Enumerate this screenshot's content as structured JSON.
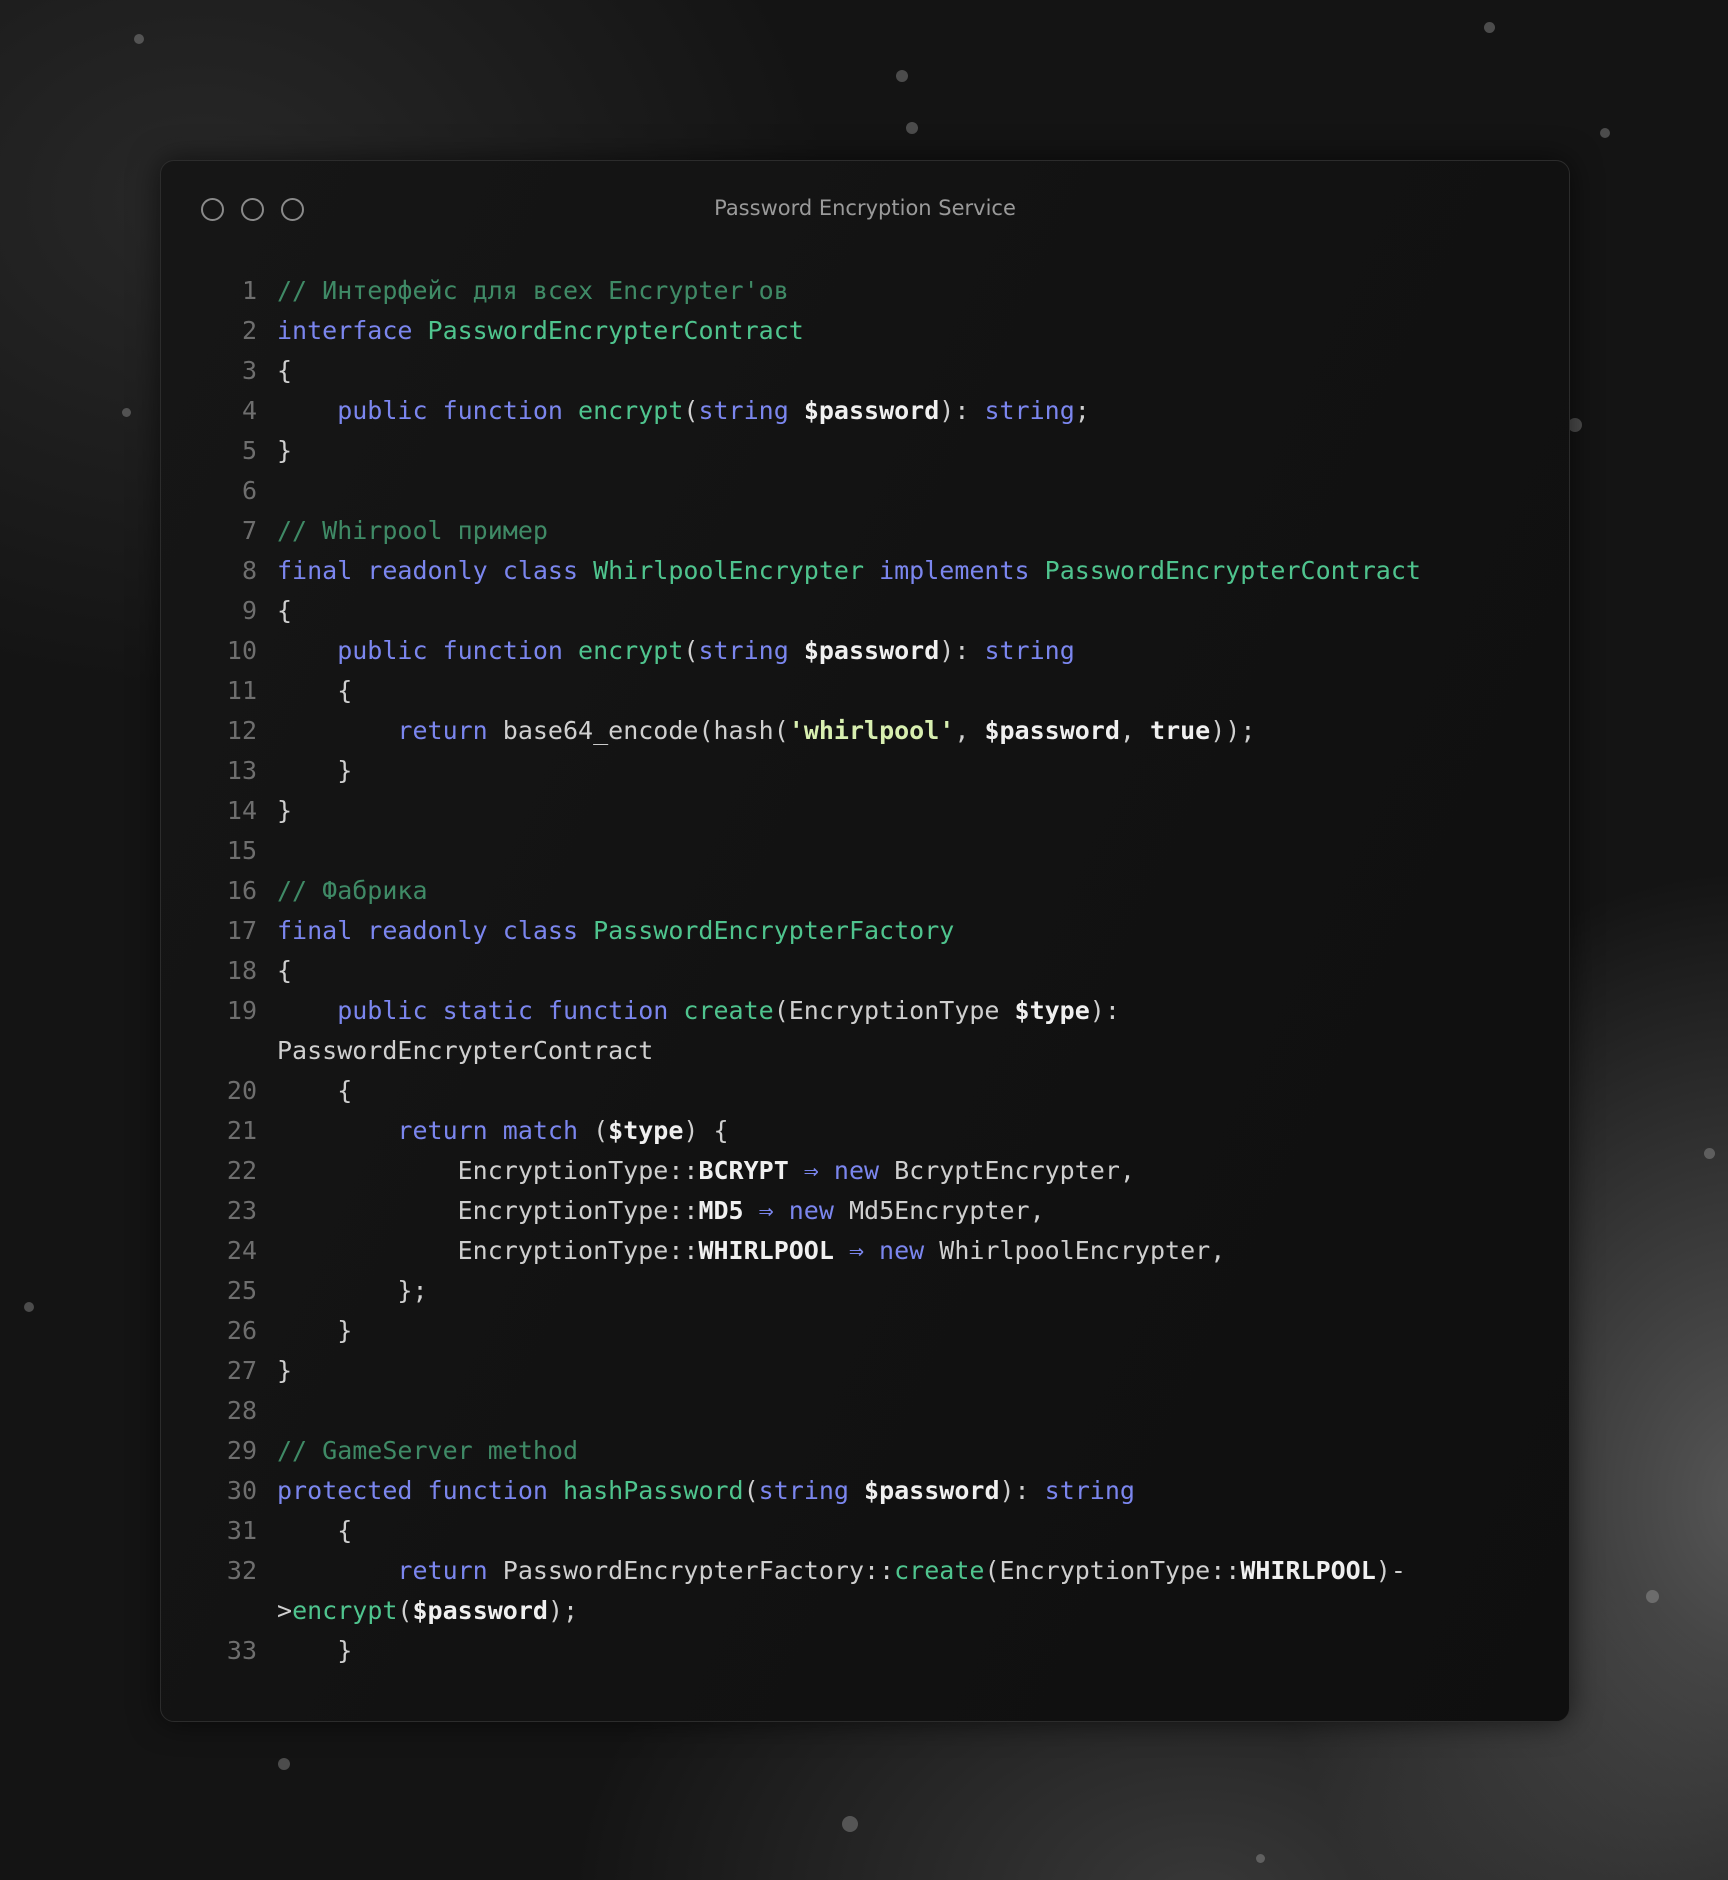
{
  "window": {
    "title": "Password Encryption Service"
  },
  "colors": {
    "keyword": "#7b86ee",
    "identifier": "#4fc48e",
    "comment": "#3f8a66",
    "string": "#d8efb0",
    "text": "#cfcfcf"
  },
  "code": {
    "lines": [
      {
        "n": "1",
        "t": [
          [
            "c",
            "// Интерфейс для всех Encrypter'ов"
          ]
        ]
      },
      {
        "n": "2",
        "t": [
          [
            "k",
            "interface "
          ],
          [
            "f",
            "PasswordEncrypterContract"
          ]
        ]
      },
      {
        "n": "3",
        "t": [
          [
            "p",
            "{"
          ]
        ]
      },
      {
        "n": "4",
        "t": [
          [
            "k",
            "    public function "
          ],
          [
            "f",
            "encrypt"
          ],
          [
            "p",
            "("
          ],
          [
            "k",
            "string "
          ],
          [
            "v",
            "$password"
          ],
          [
            "p",
            "): "
          ],
          [
            "k",
            "string"
          ],
          [
            "p",
            ";"
          ]
        ]
      },
      {
        "n": "5",
        "t": [
          [
            "p",
            "}"
          ]
        ]
      },
      {
        "n": "6",
        "t": []
      },
      {
        "n": "7",
        "t": [
          [
            "c",
            "// Whirpool пример"
          ]
        ]
      },
      {
        "n": "8",
        "t": [
          [
            "k",
            "final readonly class "
          ],
          [
            "f",
            "WhirlpoolEncrypter "
          ],
          [
            "k",
            "implements "
          ],
          [
            "f",
            "PasswordEncrypterContract"
          ]
        ]
      },
      {
        "n": "9",
        "t": [
          [
            "p",
            "{"
          ]
        ]
      },
      {
        "n": "10",
        "t": [
          [
            "k",
            "    public function "
          ],
          [
            "f",
            "encrypt"
          ],
          [
            "p",
            "("
          ],
          [
            "k",
            "string "
          ],
          [
            "v",
            "$password"
          ],
          [
            "p",
            "): "
          ],
          [
            "k",
            "string"
          ]
        ]
      },
      {
        "n": "11",
        "t": [
          [
            "p",
            "    {"
          ]
        ]
      },
      {
        "n": "12",
        "t": [
          [
            "k",
            "        return "
          ],
          [
            "p",
            "base64_encode(hash("
          ],
          [
            "s",
            "'whirlpool'"
          ],
          [
            "p",
            ", "
          ],
          [
            "v",
            "$password"
          ],
          [
            "p",
            ", "
          ],
          [
            "v",
            "true"
          ],
          [
            "p",
            "));"
          ]
        ]
      },
      {
        "n": "13",
        "t": [
          [
            "p",
            "    }"
          ]
        ]
      },
      {
        "n": "14",
        "t": [
          [
            "p",
            "}"
          ]
        ]
      },
      {
        "n": "15",
        "t": []
      },
      {
        "n": "16",
        "t": [
          [
            "c",
            "// Фабрика"
          ]
        ]
      },
      {
        "n": "17",
        "t": [
          [
            "k",
            "final readonly class "
          ],
          [
            "f",
            "PasswordEncrypterFactory"
          ]
        ]
      },
      {
        "n": "18",
        "t": [
          [
            "p",
            "{"
          ]
        ]
      },
      {
        "n": "19",
        "t": [
          [
            "k",
            "    public static function "
          ],
          [
            "f",
            "create"
          ],
          [
            "p",
            "(EncryptionType "
          ],
          [
            "v",
            "$type"
          ],
          [
            "p",
            "):"
          ]
        ]
      },
      {
        "n": "",
        "t": [
          [
            "p",
            "PasswordEncrypterContract"
          ]
        ]
      },
      {
        "n": "20",
        "t": [
          [
            "p",
            "    {"
          ]
        ]
      },
      {
        "n": "21",
        "t": [
          [
            "k",
            "        return match "
          ],
          [
            "p",
            "("
          ],
          [
            "v",
            "$type"
          ],
          [
            "p",
            ") {"
          ]
        ]
      },
      {
        "n": "22",
        "t": [
          [
            "p",
            "            EncryptionType::"
          ],
          [
            "v",
            "BCRYPT "
          ],
          [
            "k",
            "⇒ new "
          ],
          [
            "p",
            "BcryptEncrypter,"
          ]
        ]
      },
      {
        "n": "23",
        "t": [
          [
            "p",
            "            EncryptionType::"
          ],
          [
            "v",
            "MD5 "
          ],
          [
            "k",
            "⇒ new "
          ],
          [
            "p",
            "Md5Encrypter,"
          ]
        ]
      },
      {
        "n": "24",
        "t": [
          [
            "p",
            "            EncryptionType::"
          ],
          [
            "v",
            "WHIRLPOOL "
          ],
          [
            "k",
            "⇒ new "
          ],
          [
            "p",
            "WhirlpoolEncrypter,"
          ]
        ]
      },
      {
        "n": "25",
        "t": [
          [
            "p",
            "        };"
          ]
        ]
      },
      {
        "n": "26",
        "t": [
          [
            "p",
            "    }"
          ]
        ]
      },
      {
        "n": "27",
        "t": [
          [
            "p",
            "}"
          ]
        ]
      },
      {
        "n": "28",
        "t": []
      },
      {
        "n": "29",
        "t": [
          [
            "c",
            "// GameServer method"
          ]
        ]
      },
      {
        "n": "30",
        "t": [
          [
            "k",
            "protected function "
          ],
          [
            "f",
            "hashPassword"
          ],
          [
            "p",
            "("
          ],
          [
            "k",
            "string "
          ],
          [
            "v",
            "$password"
          ],
          [
            "p",
            "): "
          ],
          [
            "k",
            "string"
          ]
        ]
      },
      {
        "n": "31",
        "t": [
          [
            "p",
            "    {"
          ]
        ]
      },
      {
        "n": "32",
        "t": [
          [
            "k",
            "        return "
          ],
          [
            "p",
            "PasswordEncrypterFactory::"
          ],
          [
            "f",
            "create"
          ],
          [
            "p",
            "(EncryptionType::"
          ],
          [
            "v",
            "WHIRLPOOL"
          ],
          [
            "p",
            ")-"
          ]
        ]
      },
      {
        "n": "",
        "t": [
          [
            "p",
            ">"
          ],
          [
            "f",
            "encrypt"
          ],
          [
            "p",
            "("
          ],
          [
            "v",
            "$password"
          ],
          [
            "p",
            ");"
          ]
        ]
      },
      {
        "n": "33",
        "t": [
          [
            "p",
            "    }"
          ]
        ]
      }
    ]
  }
}
